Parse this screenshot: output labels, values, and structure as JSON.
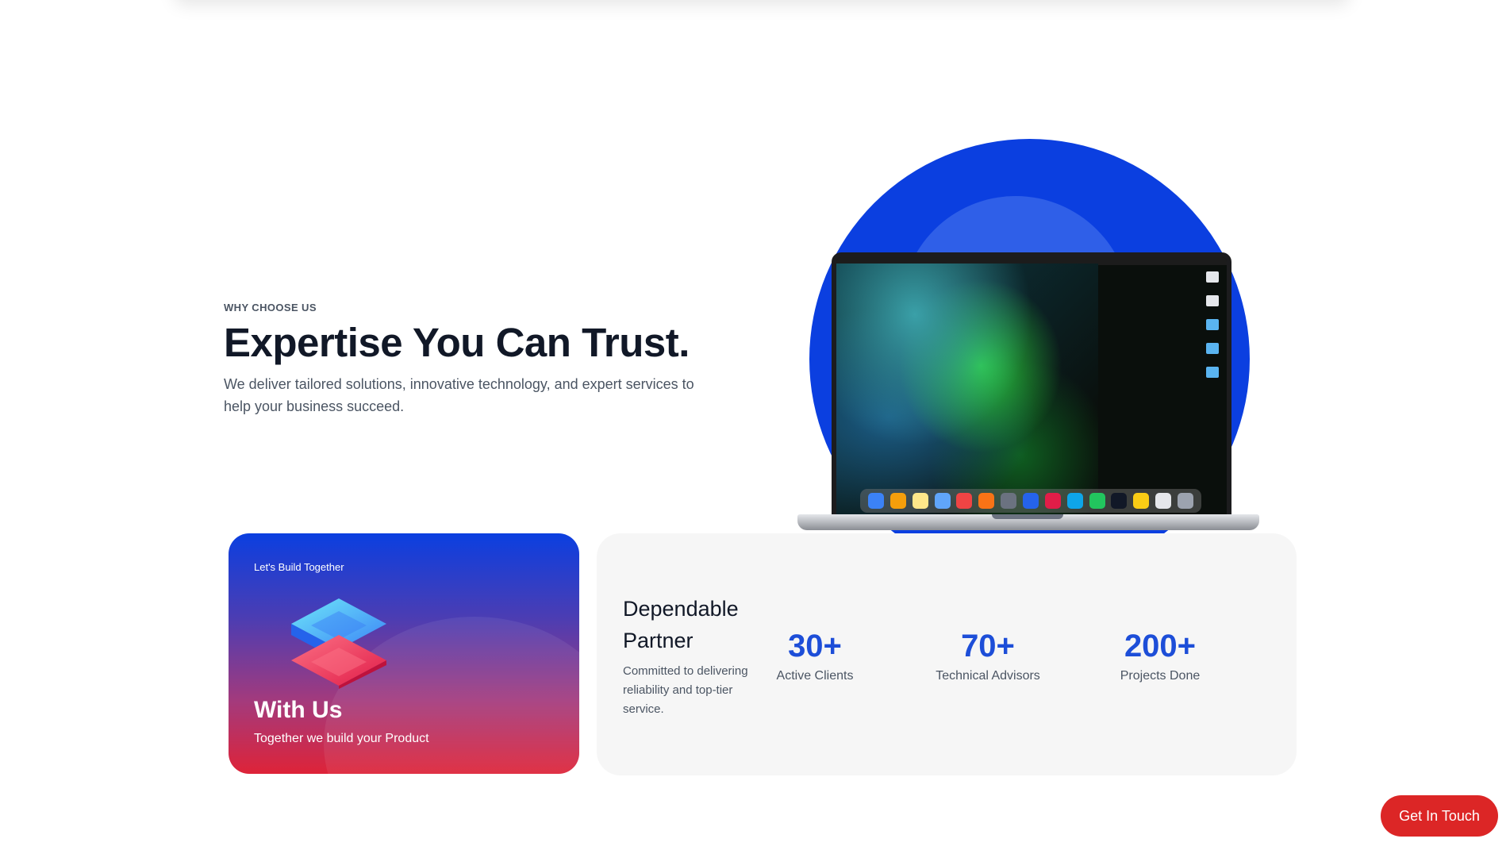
{
  "hero": {
    "eyebrow": "WHY CHOOSE US",
    "title": "Expertise You Can Trust.",
    "subtitle": "We deliver tailored solutions, innovative technology, and expert services to help your business succeed."
  },
  "build_card": {
    "eyebrow": "Let's Build Together",
    "title": "With Us",
    "subtitle": "Together we build your Product"
  },
  "stats_card": {
    "title": "Dependable Partner",
    "description": "Committed to delivering reliability and top-tier service.",
    "stats": [
      {
        "value": "30+",
        "label": "Active Clients"
      },
      {
        "value": "70+",
        "label": "Technical Advisors"
      },
      {
        "value": "200+",
        "label": "Projects Done"
      }
    ]
  },
  "cta": {
    "label": "Get In Touch"
  },
  "colors": {
    "brand_blue": "#0b3fe0",
    "accent_red": "#dc2626",
    "stat_blue": "#1d4ed8"
  }
}
